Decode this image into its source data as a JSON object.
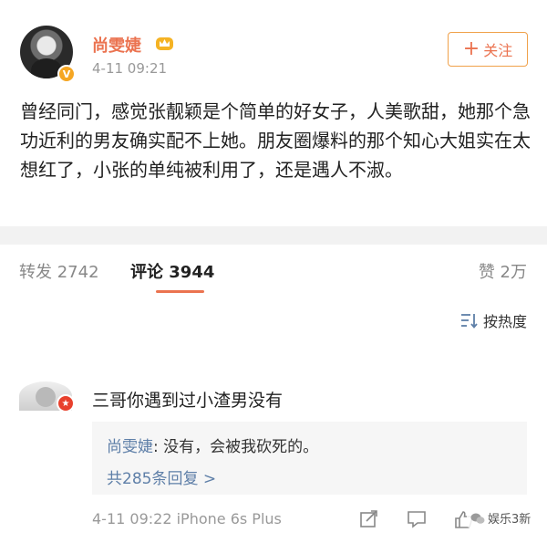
{
  "post": {
    "username": "尚雯婕",
    "verified_badge": "V",
    "timestamp": "4-11 09:21",
    "follow_label": "关注",
    "follow_icon": "+",
    "content": "曾经同门，感觉张靓颖是个简单的好女子，人美歌甜，她那个急功近利的男友确实配不上她。朋友圈爆料的那个知心大姐实在太想红了，小张的单纯被利用了，还是遇人不淑。"
  },
  "tabs": {
    "repost": "转发 2742",
    "comment_label": "评论",
    "comment_count": "3944",
    "like": "赞 2万"
  },
  "sort": {
    "label": "按热度",
    "icon": "sort-icon"
  },
  "comment": {
    "text": "三哥你遇到过小渣男没有",
    "reply_author": "尚雯婕",
    "reply_text": ": 没有，会被我砍死的。",
    "reply_more": "共285条回复 >",
    "meta": "4-11 09:22  iPhone 6s Plus"
  },
  "watermark": "娱乐3新",
  "colors": {
    "accent": "#eb7350",
    "link": "#5e7fa8",
    "badge": "#f5a623"
  }
}
